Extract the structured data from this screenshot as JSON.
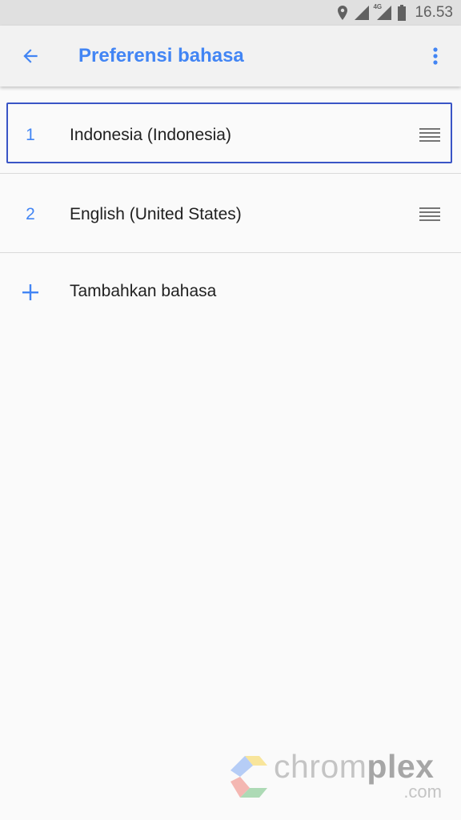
{
  "status_bar": {
    "network": "4G",
    "time": "16.53",
    "icons": [
      "location-icon",
      "signal-icon",
      "signal-4g-icon",
      "battery-icon"
    ]
  },
  "app_bar": {
    "title": "Preferensi bahasa",
    "back_icon": "arrow-back-icon",
    "menu_icon": "more-vert-icon"
  },
  "languages": [
    {
      "number": "1",
      "label": "Indonesia (Indonesia)",
      "focused": true
    },
    {
      "number": "2",
      "label": "English (United States)",
      "focused": false
    }
  ],
  "add_language": {
    "label": "Tambahkan bahasa",
    "icon": "plus-icon"
  },
  "watermark": {
    "text_light": "chrom",
    "text_bold": "plex",
    "domain": ".com"
  },
  "colors": {
    "accent": "#4285f4",
    "focus_border": "#3a55c6",
    "text": "#212121"
  }
}
